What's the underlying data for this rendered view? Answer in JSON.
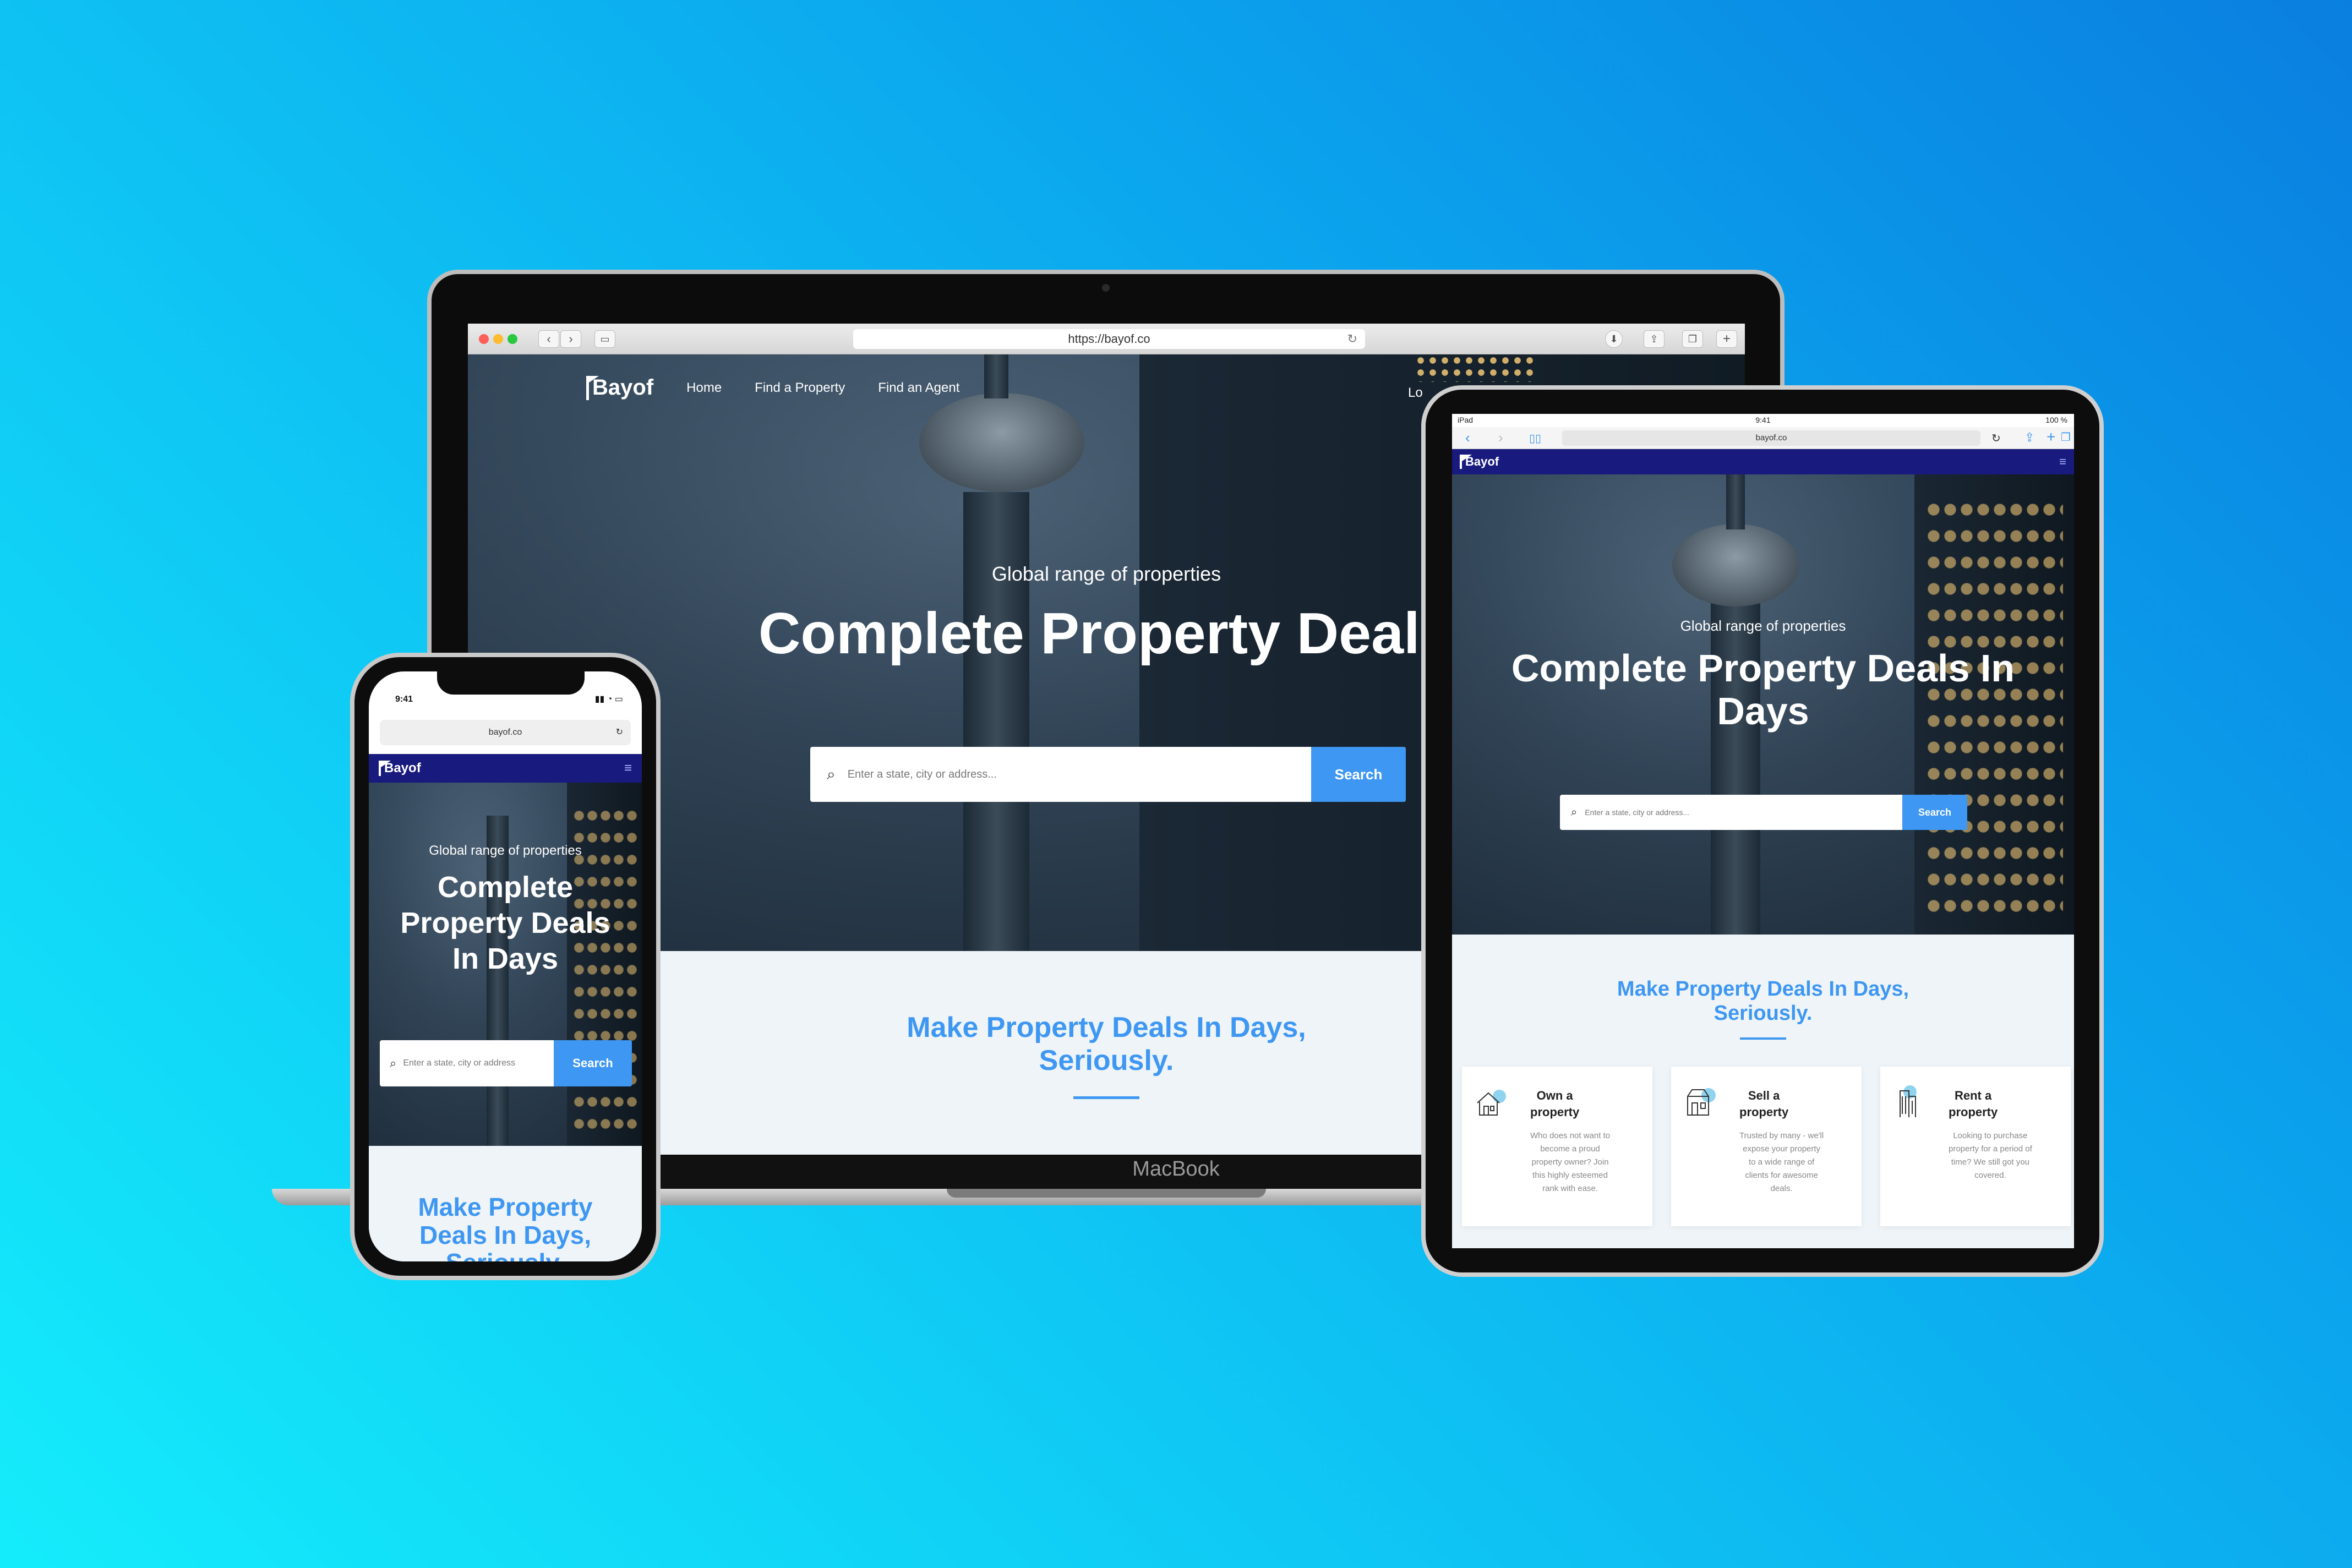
{
  "brand": {
    "name": "Bayof"
  },
  "macbook": {
    "device_label": "MacBook",
    "url": "https://bayof.co",
    "nav": {
      "home": "Home",
      "find_property": "Find a Property",
      "find_agent": "Find an Agent",
      "login_partial": "Lo"
    },
    "hero": {
      "kicker": "Global range of properties",
      "headline": "Complete Property Deals In"
    },
    "search": {
      "placeholder": "Enter a state, city or address...",
      "button": "Search"
    },
    "deals": {
      "line1": "Make Property Deals In Days,",
      "line2": "Seriously."
    }
  },
  "ipad": {
    "status": {
      "left": "iPad",
      "time": "9:41",
      "battery": "100 %"
    },
    "url": "bayof.co",
    "hero": {
      "kicker": "Global range of properties",
      "headline_line1": "Complete Property Deals In",
      "headline_line2": "Days"
    },
    "search": {
      "placeholder": "Enter a state, city or address...",
      "button": "Search"
    },
    "deals": {
      "line1": "Make Property Deals In Days,",
      "line2": "Seriously."
    },
    "cards": [
      {
        "title_line1": "Own a",
        "title_line2": "property",
        "desc": [
          "Who does not want to",
          "become a proud",
          "property owner? Join",
          "this highly esteemed",
          "rank with ease."
        ],
        "icon": "house-icon"
      },
      {
        "title_line1": "Sell a",
        "title_line2": "property",
        "desc": [
          "Trusted by many - we'll",
          "expose your property",
          "to a wide range of",
          "clients for awesome",
          "deals."
        ],
        "icon": "shop-icon"
      },
      {
        "title_line1": "Rent a",
        "title_line2": "property",
        "desc": [
          "Looking to purchase",
          "property for a period of",
          "time? We still got you",
          "covered."
        ],
        "icon": "building-icon"
      }
    ]
  },
  "iphone": {
    "time": "9:41",
    "url": "bayof.co",
    "hero": {
      "kicker": "Global range of properties",
      "line1": "Complete",
      "line2": "Property Deals",
      "line3": "In Days"
    },
    "search": {
      "placeholder": "Enter a state, city or address",
      "button": "Search"
    },
    "deals": {
      "line1": "Make Property",
      "line2": "Deals In Days,",
      "line3": "Seriously."
    }
  },
  "colors": {
    "accent": "#3e97f2",
    "brandbar": "#191a7e",
    "section_bg": "#eef4f8"
  }
}
